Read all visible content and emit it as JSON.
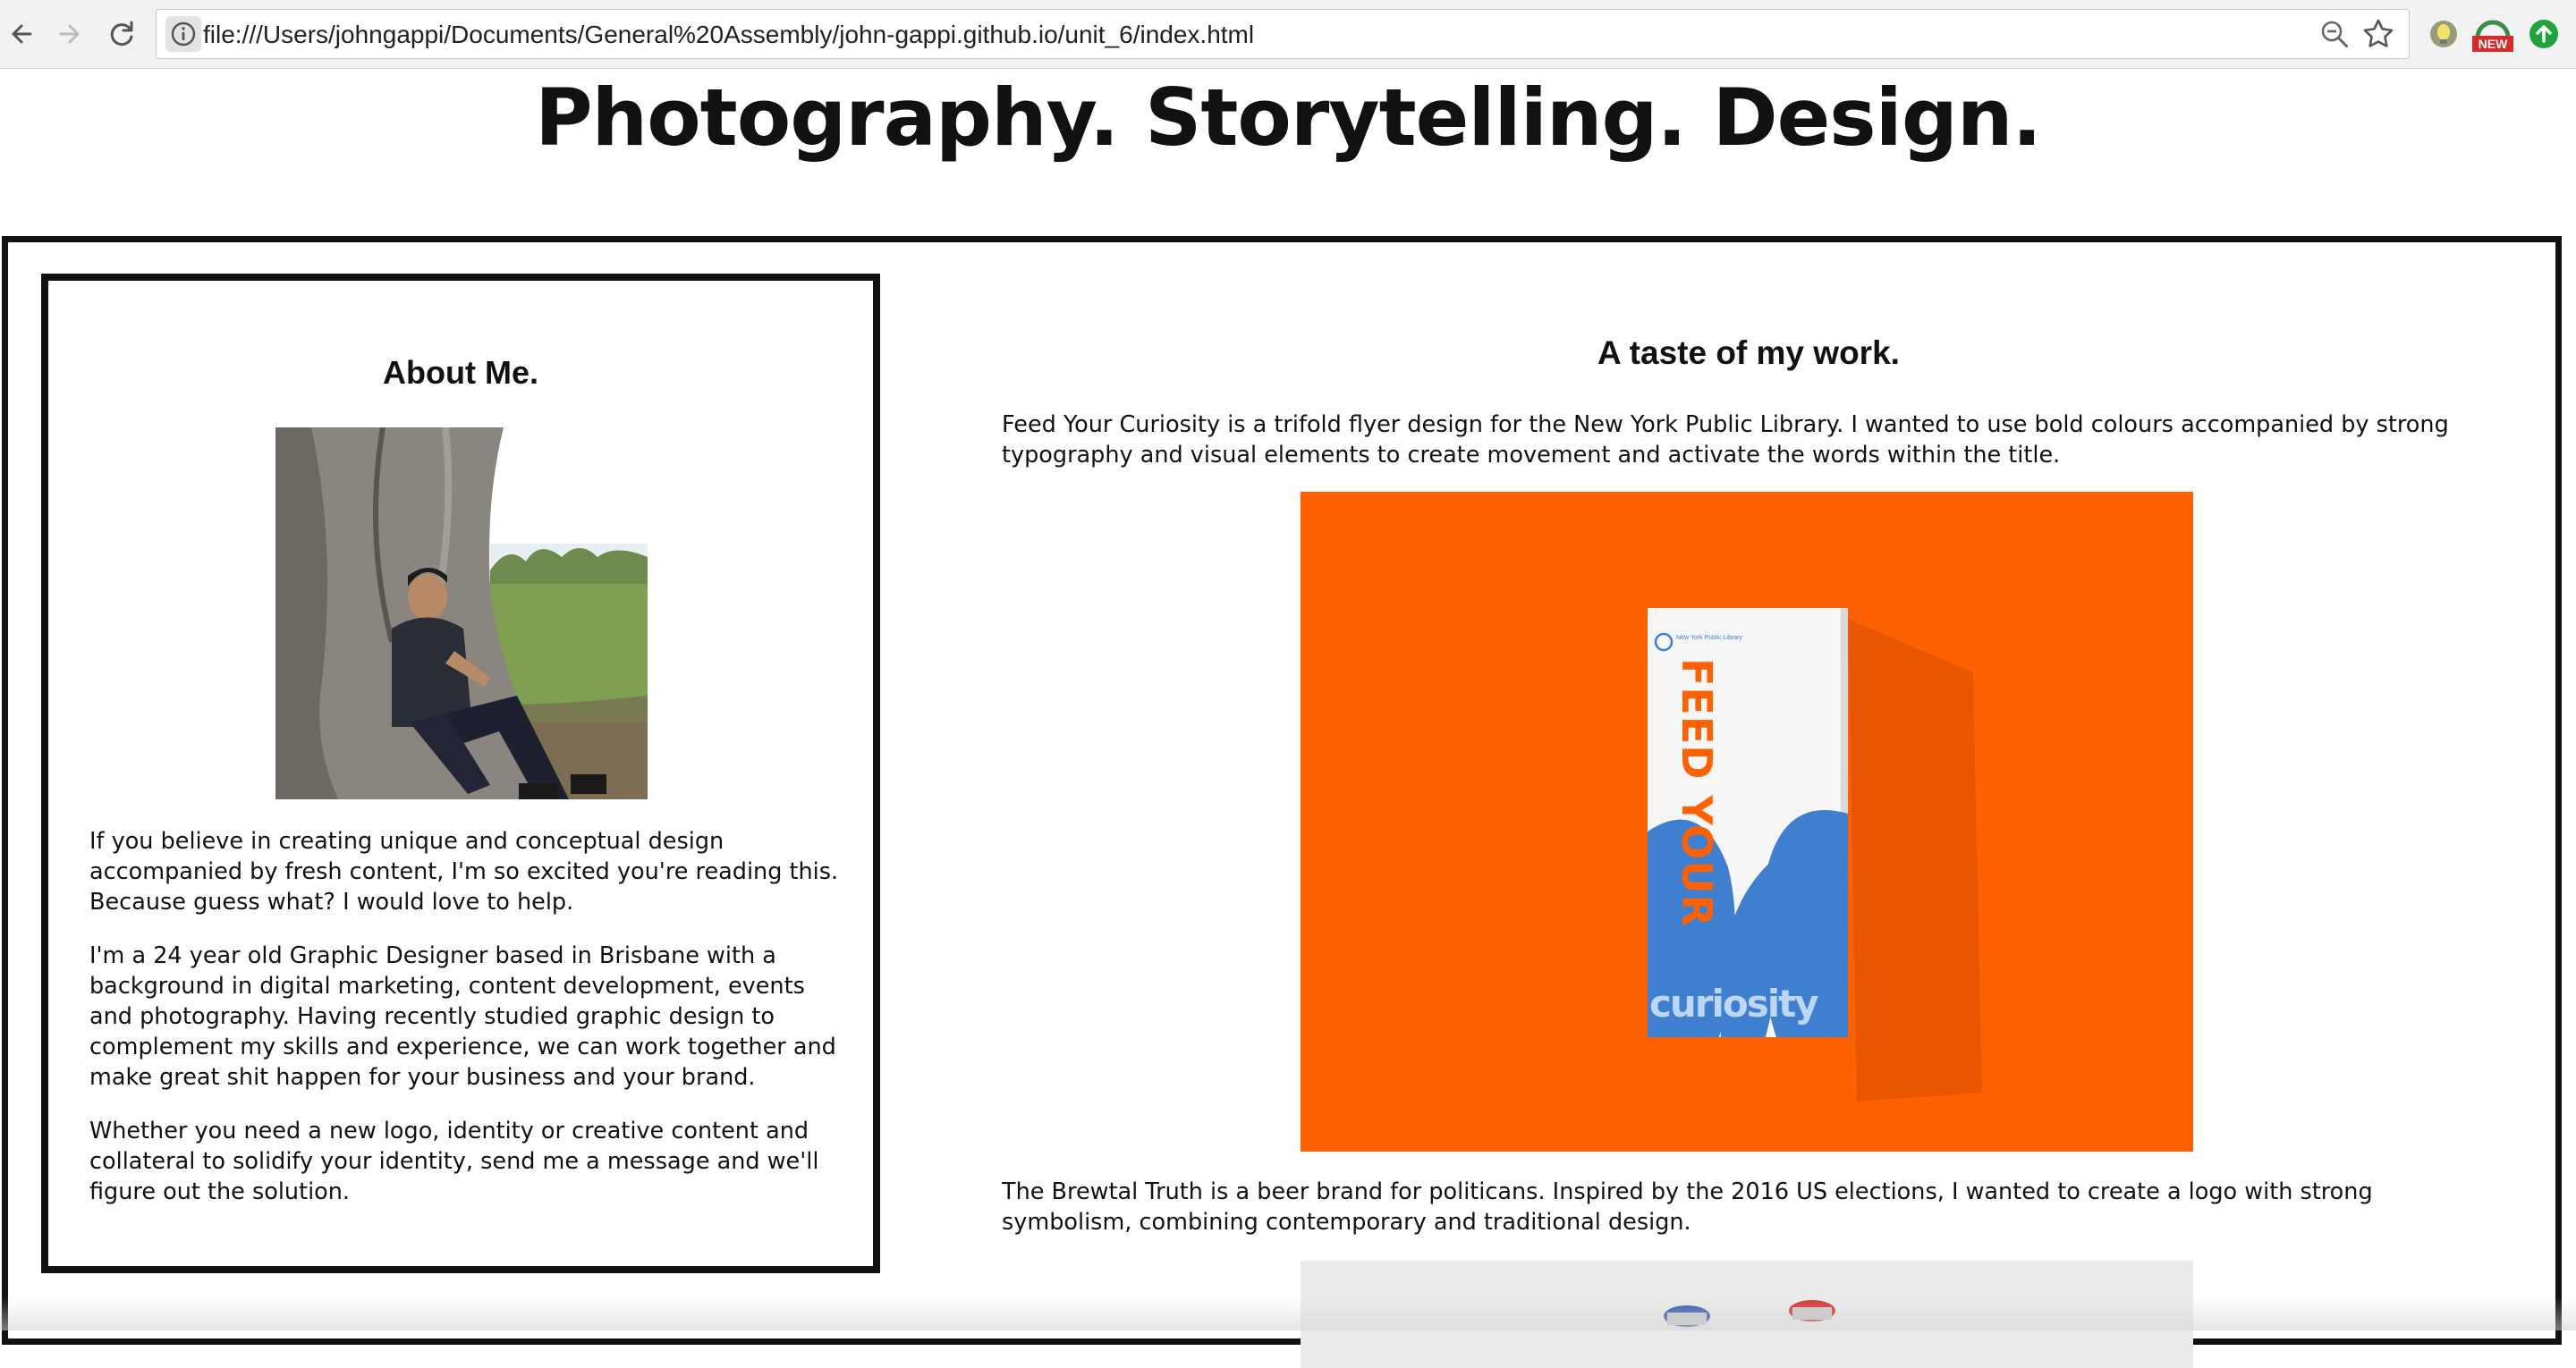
{
  "browser": {
    "url": "file:///Users/johngappi/Documents/General%20Assembly/john-gappi.github.io/unit_6/index.html",
    "extension_badge": "NEW",
    "icons": [
      "back-icon",
      "forward-icon",
      "reload-icon",
      "info-icon",
      "zoom-icon",
      "bookmark-star-icon",
      "bulb-extension-icon",
      "new-extension-icon",
      "update-arrow-icon"
    ]
  },
  "page": {
    "title": "Photography. Storytelling. Design.",
    "about": {
      "heading": "About Me.",
      "paragraphs": [
        "If you believe in creating unique and conceptual design accompanied by fresh content, I'm so excited you're reading this. Because guess what? I would love to help.",
        "I'm a 24 year old Graphic Designer based in Brisbane with a background in digital marketing, content development, events and photography. Having recently studied graphic design to complement my skills and experience, we can work together and make great shit happen for your business and your brand.",
        "Whether you need a new logo, identity or creative content and collateral to solidify your identity, send me a message and we'll figure out the solution."
      ]
    },
    "work": {
      "heading": "A taste of my work.",
      "projects": [
        {
          "name": "Feed Your Curiosity",
          "description": " is a trifold flyer design for the New York Public Library. I wanted to use bold colours accompanied by strong typography and visual elements to create movement and activate the words within the title.",
          "flyer_title": "FEED YOUR",
          "flyer_word": "curiosity",
          "flyer_logo": "New York Public Library"
        },
        {
          "name": "The Brewtal Truth",
          "description": " is a beer brand for politicans. Inspired by the 2016 US elections, I wanted to create a logo with strong symbolism, combining contemporary and traditional design."
        }
      ]
    }
  },
  "colors": {
    "accent_orange": "#fd6102",
    "flyer_blue": "#3f7fd0",
    "frame_black": "#111111"
  }
}
